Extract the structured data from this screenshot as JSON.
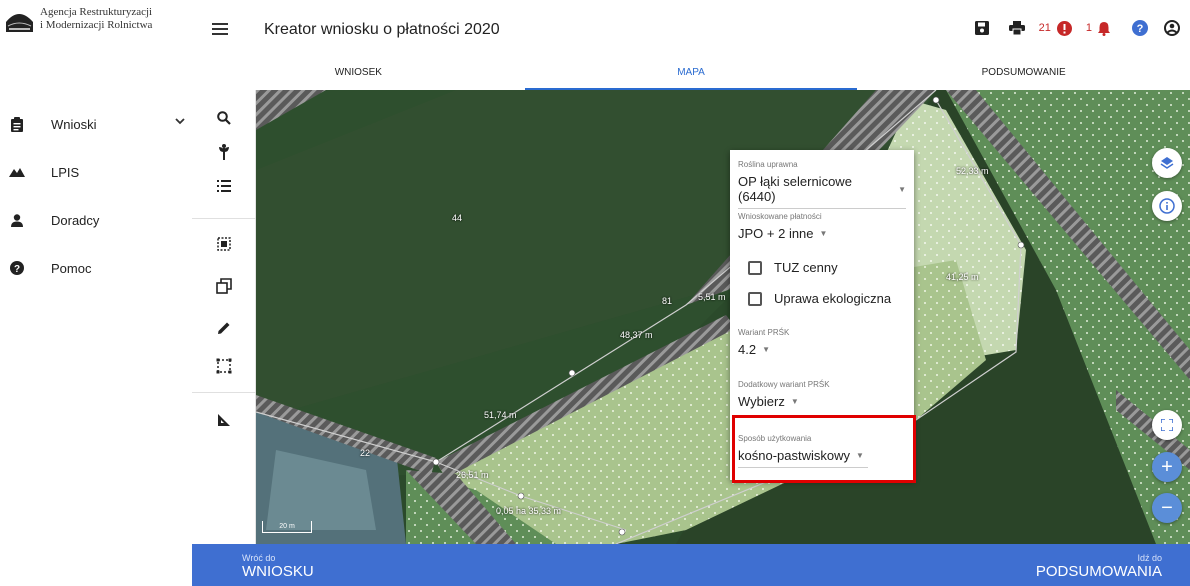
{
  "logo": {
    "line1": "Agencja Restrukturyzacji",
    "line2": "i Modernizacji Rolnictwa"
  },
  "nav": {
    "items": [
      {
        "label": "Wnioski",
        "icon": "clipboard-icon"
      },
      {
        "label": "LPIS",
        "icon": "mountains-icon"
      },
      {
        "label": "Doradcy",
        "icon": "person-icon"
      },
      {
        "label": "Pomoc",
        "icon": "help-circle-icon"
      }
    ]
  },
  "header": {
    "title": "Kreator wniosku o płatności 2020",
    "error_count": "21",
    "notification_count": "1"
  },
  "tabs": [
    {
      "label": "WNIOSEK",
      "active": false
    },
    {
      "label": "MAPA",
      "active": true
    },
    {
      "label": "PODSUMOWANIE",
      "active": false
    }
  ],
  "map": {
    "labels": {
      "parcel_44": "44",
      "parcel_81": "81",
      "parcel_22": "22",
      "seg_1": "52,33 m",
      "seg_2": "41,25 m",
      "seg_3": "5,51 m",
      "seg_4": "48,37 m",
      "seg_5": "51,74 m",
      "seg_6": "26,51 m",
      "seg_7": "0,05 ha 35,33 m"
    },
    "scale_label": "20 m"
  },
  "popup": {
    "crop": {
      "caption": "Roślina uprawna",
      "value": "OP łąki selernicowe (6440)"
    },
    "payments": {
      "caption": "Wnioskowane płatności",
      "value": "JPO + 2 inne"
    },
    "checkbox_tuz": "TUZ cenny",
    "checkbox_eco": "Uprawa ekologiczna",
    "variant": {
      "caption": "Wariant PRŚK",
      "value": "4.2"
    },
    "extra_variant": {
      "caption": "Dodatkowy wariant PRŚK",
      "value": "Wybierz"
    },
    "usage": {
      "caption": "Sposób użytkowania",
      "value": "kośno-pastwiskowy"
    }
  },
  "footer": {
    "back_small": "Wróć do",
    "back_big": "WNIOSKU",
    "next_small": "Idź do",
    "next_big": "PODSUMOWANIA"
  },
  "colors": {
    "accent": "#3f6fd1",
    "tab_active": "#2a6bd0",
    "highlight": "#e00000",
    "alert": "#c62828"
  }
}
